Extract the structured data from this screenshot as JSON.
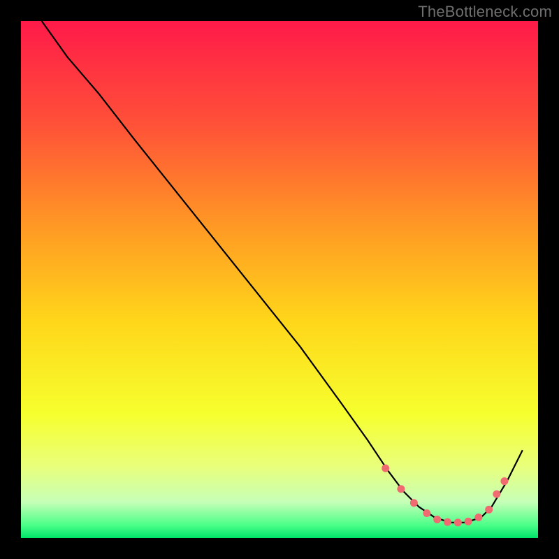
{
  "attribution": "TheBottleneck.com",
  "chart_data": {
    "type": "line",
    "title": "",
    "xlabel": "",
    "ylabel": "",
    "ylim": [
      0,
      100
    ],
    "xlim": [
      0,
      100
    ],
    "gradient_stops": [
      {
        "offset": 0.0,
        "color": "#ff1a49"
      },
      {
        "offset": 0.2,
        "color": "#ff5138"
      },
      {
        "offset": 0.4,
        "color": "#ff9a24"
      },
      {
        "offset": 0.58,
        "color": "#ffd61a"
      },
      {
        "offset": 0.76,
        "color": "#f6ff2e"
      },
      {
        "offset": 0.86,
        "color": "#e9ff7a"
      },
      {
        "offset": 0.93,
        "color": "#c7ffb8"
      },
      {
        "offset": 0.975,
        "color": "#4bff88"
      },
      {
        "offset": 1.0,
        "color": "#00e46a"
      }
    ],
    "series": [
      {
        "name": "bottleneck-curve",
        "x": [
          4,
          9,
          15,
          22,
          30,
          38,
          46,
          54,
          62,
          67,
          71,
          74,
          77,
          80,
          83,
          86,
          89,
          91,
          94,
          97
        ],
        "y": [
          100,
          93,
          86,
          77,
          67,
          57,
          47,
          37,
          26,
          19,
          13,
          9,
          6,
          4,
          3,
          3,
          4,
          6,
          11,
          17
        ]
      }
    ],
    "markers": {
      "name": "highlight-points",
      "color": "#f06a72",
      "x": [
        70.5,
        73.5,
        76,
        78.5,
        80.5,
        82.5,
        84.5,
        86.5,
        88.5,
        90.5,
        92.0,
        93.5
      ],
      "y": [
        13.5,
        9.5,
        6.8,
        4.8,
        3.6,
        3.1,
        3.0,
        3.2,
        4.0,
        5.5,
        8.5,
        11.0
      ]
    }
  }
}
